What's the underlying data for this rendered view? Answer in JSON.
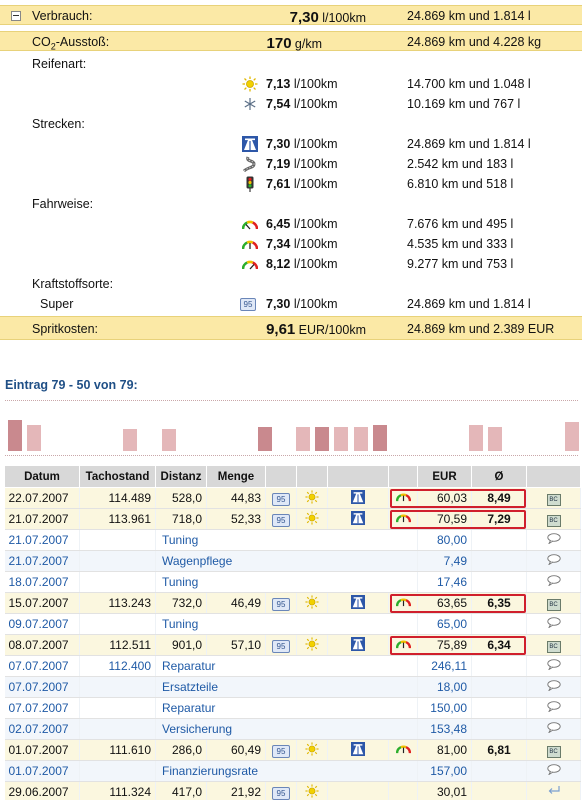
{
  "summary": {
    "verbrauch": {
      "label": "Verbrauch:",
      "value": "7,30",
      "unit": "l/100km",
      "range": "24.869 km und 1.814 l"
    },
    "co2": {
      "label_pre": "CO",
      "label_sub": "2",
      "label_post": "-Ausstoß:",
      "value": "170",
      "unit": "g/km",
      "range": "24.869 km und 4.228 kg"
    },
    "reifenart": {
      "label": "Reifenart:",
      "rows": [
        {
          "icon": "sun-icon",
          "value": "7,13",
          "unit": "l/100km",
          "range": "14.700 km und 1.048 l"
        },
        {
          "icon": "snowflake-icon",
          "value": "7,54",
          "unit": "l/100km",
          "range": "10.169 km und 767 l"
        }
      ]
    },
    "strecken": {
      "label": "Strecken:",
      "rows": [
        {
          "icon": "highway-icon",
          "value": "7,30",
          "unit": "l/100km",
          "range": "24.869 km und 1.814 l"
        },
        {
          "icon": "country-road-icon",
          "value": "7,19",
          "unit": "l/100km",
          "range": "2.542 km und 183 l"
        },
        {
          "icon": "traffic-light-icon",
          "value": "7,61",
          "unit": "l/100km",
          "range": "6.810 km und 518 l"
        }
      ]
    },
    "fahrweise": {
      "label": "Fahrweise:",
      "rows": [
        {
          "icon": "gauge-icon",
          "value": "6,45",
          "unit": "l/100km",
          "range": "7.676 km und 495 l"
        },
        {
          "icon": "gauge-icon",
          "value": "7,34",
          "unit": "l/100km",
          "range": "4.535 km und 333 l"
        },
        {
          "icon": "gauge-icon",
          "value": "8,12",
          "unit": "l/100km",
          "range": "9.277 km und 753 l"
        }
      ]
    },
    "kraftstoff": {
      "label": "Kraftstoffsorte:",
      "rows": [
        {
          "name": "Super",
          "badge": "95",
          "value": "7,30",
          "unit": "l/100km",
          "range": "24.869 km und 1.814 l"
        }
      ]
    },
    "spritkosten": {
      "label": "Spritkosten:",
      "value": "9,61",
      "unit": "EUR/100km",
      "range": "24.869 km und 2.389 EUR"
    }
  },
  "entries_title": "Eintrag 79 - 50 von 79:",
  "histogram": [
    {
      "pos": 0,
      "h": 0.65,
      "color": "#c9898e"
    },
    {
      "pos": 1,
      "h": 0.55,
      "color": "#e4b7b9"
    },
    {
      "pos": 6,
      "h": 0.45,
      "color": "#e4b7b9"
    },
    {
      "pos": 8,
      "h": 0.45,
      "color": "#e4b7b9"
    },
    {
      "pos": 13,
      "h": 0.5,
      "color": "#c9898e"
    },
    {
      "pos": 15,
      "h": 0.5,
      "color": "#e4b7b9"
    },
    {
      "pos": 16,
      "h": 0.5,
      "color": "#c9898e"
    },
    {
      "pos": 17,
      "h": 0.5,
      "color": "#e4b7b9"
    },
    {
      "pos": 18,
      "h": 0.5,
      "color": "#e4b7b9"
    },
    {
      "pos": 19,
      "h": 0.55,
      "color": "#c9898e"
    },
    {
      "pos": 24,
      "h": 0.55,
      "color": "#e4b7b9"
    },
    {
      "pos": 25,
      "h": 0.5,
      "color": "#e4b7b9"
    },
    {
      "pos": 29,
      "h": 0.6,
      "color": "#e4b7b9"
    }
  ],
  "table": {
    "headers": [
      "Datum",
      "Tachostand",
      "Distanz",
      "Menge",
      "",
      "",
      "",
      "",
      "EUR",
      "Ø",
      ""
    ],
    "rows": [
      {
        "type": "fuel",
        "date": "22.07.2007",
        "tacho": "114.489",
        "dist": "528,0",
        "menge": "44,83",
        "badge": "95",
        "tire": "sun-icon",
        "road": "highway-icon",
        "drive": "gauge-icon",
        "eur": "60,03",
        "avg": "8,49",
        "action": "bc-icon",
        "highlight": true
      },
      {
        "type": "fuel",
        "date": "21.07.2007",
        "tacho": "113.961",
        "dist": "718,0",
        "menge": "52,33",
        "badge": "95",
        "tire": "sun-icon",
        "road": "highway-icon",
        "drive": "gauge-icon",
        "eur": "70,59",
        "avg": "7,29",
        "action": "bc-icon",
        "highlight": true
      },
      {
        "type": "link",
        "date": "21.07.2007",
        "tacho": "",
        "desc": "Tuning",
        "eur": "80,00",
        "action": "comment-icon"
      },
      {
        "type": "link",
        "date": "21.07.2007",
        "tacho": "",
        "desc": "Wagenpflege",
        "eur": "7,49",
        "action": "comment-icon"
      },
      {
        "type": "link",
        "date": "18.07.2007",
        "tacho": "",
        "desc": "Tuning",
        "eur": "17,46",
        "action": "comment-icon"
      },
      {
        "type": "fuel",
        "date": "15.07.2007",
        "tacho": "113.243",
        "dist": "732,0",
        "menge": "46,49",
        "badge": "95",
        "tire": "sun-icon",
        "road": "highway-icon",
        "drive": "gauge-icon",
        "eur": "63,65",
        "avg": "6,35",
        "action": "bc-icon",
        "highlight": true
      },
      {
        "type": "link",
        "date": "09.07.2007",
        "tacho": "",
        "desc": "Tuning",
        "eur": "65,00",
        "action": "comment-icon"
      },
      {
        "type": "fuel",
        "date": "08.07.2007",
        "tacho": "112.511",
        "dist": "901,0",
        "menge": "57,10",
        "badge": "95",
        "tire": "sun-icon",
        "road": "highway-icon",
        "drive": "gauge-icon",
        "eur": "75,89",
        "avg": "6,34",
        "action": "bc-icon",
        "highlight": true
      },
      {
        "type": "link",
        "date": "07.07.2007",
        "tacho": "112.400",
        "desc": "Reparatur",
        "eur": "246,11",
        "action": "comment-icon"
      },
      {
        "type": "link",
        "date": "07.07.2007",
        "tacho": "",
        "desc": "Ersatzteile",
        "eur": "18,00",
        "action": "comment-icon"
      },
      {
        "type": "link",
        "date": "07.07.2007",
        "tacho": "",
        "desc": "Reparatur",
        "eur": "150,00",
        "action": "comment-icon"
      },
      {
        "type": "link",
        "date": "02.07.2007",
        "tacho": "",
        "desc": "Versicherung",
        "eur": "153,48",
        "action": "comment-icon"
      },
      {
        "type": "fuel",
        "date": "01.07.2007",
        "tacho": "111.610",
        "dist": "286,0",
        "menge": "60,49",
        "badge": "95",
        "tire": "sun-icon",
        "road": "highway-icon",
        "drive": "gauge-icon",
        "eur": "81,00",
        "avg": "6,81",
        "action": "bc-icon",
        "highlight": false
      },
      {
        "type": "link",
        "date": "01.07.2007",
        "tacho": "",
        "desc": "Finanzierungsrate",
        "eur": "157,00",
        "action": "comment-icon"
      },
      {
        "type": "fuel",
        "date": "29.06.2007",
        "tacho": "111.324",
        "dist": "417,0",
        "menge": "21,92",
        "badge": "95",
        "tire": "sun-icon",
        "road": "",
        "drive": "",
        "eur": "30,01",
        "avg": "",
        "action": "return-icon",
        "highlight": false
      }
    ]
  },
  "colors": {
    "highlight_bg": "#fbe9a6",
    "link": "#1f5aa6",
    "red_box": "#d01f2c"
  }
}
